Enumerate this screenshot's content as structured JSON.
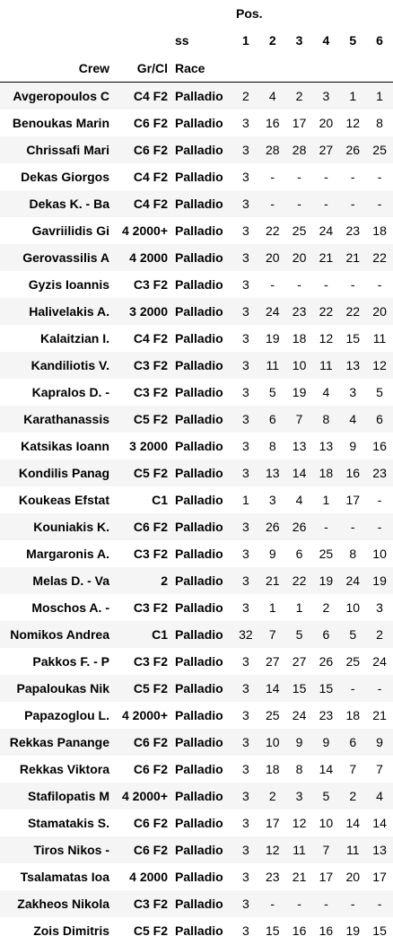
{
  "header": {
    "pos_label": "Pos.",
    "ss_label": "ss",
    "crew_label": "Crew",
    "grcl_label": "Gr/Cl",
    "race_label": "Race",
    "stage_numbers": [
      "1",
      "2",
      "3",
      "4",
      "5",
      "6"
    ]
  },
  "rows": [
    {
      "crew": "Avgeropoulos C",
      "gr": "C4 F2",
      "race": "Palladio",
      "pos": [
        "2",
        "4",
        "2",
        "3",
        "1",
        "1"
      ]
    },
    {
      "crew": "Benoukas Marin",
      "gr": "C6 F2",
      "race": "Palladio",
      "pos": [
        "3",
        "16",
        "17",
        "20",
        "12",
        "8"
      ]
    },
    {
      "crew": "Chrissafi Mari",
      "gr": "C6 F2",
      "race": "Palladio",
      "pos": [
        "3",
        "28",
        "28",
        "27",
        "26",
        "25"
      ]
    },
    {
      "crew": "Dekas Giorgos",
      "gr": "C4 F2",
      "race": "Palladio",
      "pos": [
        "3",
        "-",
        "-",
        "-",
        "-",
        "-"
      ]
    },
    {
      "crew": "Dekas K. - Ba",
      "gr": "C4 F2",
      "race": "Palladio",
      "pos": [
        "3",
        "-",
        "-",
        "-",
        "-",
        "-"
      ]
    },
    {
      "crew": "Gavriilidis Gi",
      "gr": "4 2000+",
      "race": "Palladio",
      "pos": [
        "3",
        "22",
        "25",
        "24",
        "23",
        "18"
      ]
    },
    {
      "crew": "Gerovassilis A",
      "gr": "4 2000",
      "race": "Palladio",
      "pos": [
        "3",
        "20",
        "20",
        "21",
        "21",
        "22"
      ]
    },
    {
      "crew": "Gyzis Ioannis",
      "gr": "C3 F2",
      "race": "Palladio",
      "pos": [
        "3",
        "-",
        "-",
        "-",
        "-",
        "-"
      ]
    },
    {
      "crew": "Halivelakis A.",
      "gr": "3 2000",
      "race": "Palladio",
      "pos": [
        "3",
        "24",
        "23",
        "22",
        "22",
        "20"
      ]
    },
    {
      "crew": "Kalaitzian I.",
      "gr": "C4 F2",
      "race": "Palladio",
      "pos": [
        "3",
        "19",
        "18",
        "12",
        "15",
        "11"
      ]
    },
    {
      "crew": "Kandiliotis V.",
      "gr": "C3 F2",
      "race": "Palladio",
      "pos": [
        "3",
        "11",
        "10",
        "11",
        "13",
        "12"
      ]
    },
    {
      "crew": "Kapralos D. -",
      "gr": "C3 F2",
      "race": "Palladio",
      "pos": [
        "3",
        "5",
        "19",
        "4",
        "3",
        "5"
      ]
    },
    {
      "crew": "Karathanassis",
      "gr": "C5 F2",
      "race": "Palladio",
      "pos": [
        "3",
        "6",
        "7",
        "8",
        "4",
        "6"
      ]
    },
    {
      "crew": "Katsikas Ioann",
      "gr": "3 2000",
      "race": "Palladio",
      "pos": [
        "3",
        "8",
        "13",
        "13",
        "9",
        "16"
      ]
    },
    {
      "crew": "Kondilis Panag",
      "gr": "C5 F2",
      "race": "Palladio",
      "pos": [
        "3",
        "13",
        "14",
        "18",
        "16",
        "23"
      ]
    },
    {
      "crew": "Koukeas Efstat",
      "gr": "C1",
      "race": "Palladio",
      "pos": [
        "1",
        "3",
        "4",
        "1",
        "17",
        "-"
      ]
    },
    {
      "crew": "Kouniakis K.",
      "gr": "C6 F2",
      "race": "Palladio",
      "pos": [
        "3",
        "26",
        "26",
        "-",
        "-",
        "-"
      ]
    },
    {
      "crew": "Margaronis A.",
      "gr": "C3 F2",
      "race": "Palladio",
      "pos": [
        "3",
        "9",
        "6",
        "25",
        "8",
        "10"
      ]
    },
    {
      "crew": "Melas D. - Va",
      "gr": "2",
      "race": "Palladio",
      "pos": [
        "3",
        "21",
        "22",
        "19",
        "24",
        "19"
      ]
    },
    {
      "crew": "Moschos A. -",
      "gr": "C3 F2",
      "race": "Palladio",
      "pos": [
        "3",
        "1",
        "1",
        "2",
        "10",
        "3"
      ]
    },
    {
      "crew": "Nomikos Andrea",
      "gr": "C1",
      "race": "Palladio",
      "pos": [
        "32",
        "7",
        "5",
        "6",
        "5",
        "2"
      ]
    },
    {
      "crew": "Pakkos F. - P",
      "gr": "C3 F2",
      "race": "Palladio",
      "pos": [
        "3",
        "27",
        "27",
        "26",
        "25",
        "24"
      ]
    },
    {
      "crew": "Papaloukas Nik",
      "gr": "C5 F2",
      "race": "Palladio",
      "pos": [
        "3",
        "14",
        "15",
        "15",
        "-",
        "-"
      ]
    },
    {
      "crew": "Papazoglou L.",
      "gr": "4 2000+",
      "race": "Palladio",
      "pos": [
        "3",
        "25",
        "24",
        "23",
        "18",
        "21"
      ]
    },
    {
      "crew": "Rekkas Panange",
      "gr": "C6 F2",
      "race": "Palladio",
      "pos": [
        "3",
        "10",
        "9",
        "9",
        "6",
        "9"
      ]
    },
    {
      "crew": "Rekkas Viktora",
      "gr": "C6 F2",
      "race": "Palladio",
      "pos": [
        "3",
        "18",
        "8",
        "14",
        "7",
        "7"
      ]
    },
    {
      "crew": "Stafilopatis M",
      "gr": "4 2000+",
      "race": "Palladio",
      "pos": [
        "3",
        "2",
        "3",
        "5",
        "2",
        "4"
      ]
    },
    {
      "crew": "Stamatakis S.",
      "gr": "C6 F2",
      "race": "Palladio",
      "pos": [
        "3",
        "17",
        "12",
        "10",
        "14",
        "14"
      ]
    },
    {
      "crew": "Tiros Nikos -",
      "gr": "C6 F2",
      "race": "Palladio",
      "pos": [
        "3",
        "12",
        "11",
        "7",
        "11",
        "13"
      ]
    },
    {
      "crew": "Tsalamatas Ioa",
      "gr": "4 2000",
      "race": "Palladio",
      "pos": [
        "3",
        "23",
        "21",
        "17",
        "20",
        "17"
      ]
    },
    {
      "crew": "Zakheos Nikola",
      "gr": "C3 F2",
      "race": "Palladio",
      "pos": [
        "3",
        "-",
        "-",
        "-",
        "-",
        "-"
      ]
    },
    {
      "crew": "Zois Dimitris",
      "gr": "C5 F2",
      "race": "Palladio",
      "pos": [
        "3",
        "15",
        "16",
        "16",
        "19",
        "15"
      ]
    }
  ]
}
